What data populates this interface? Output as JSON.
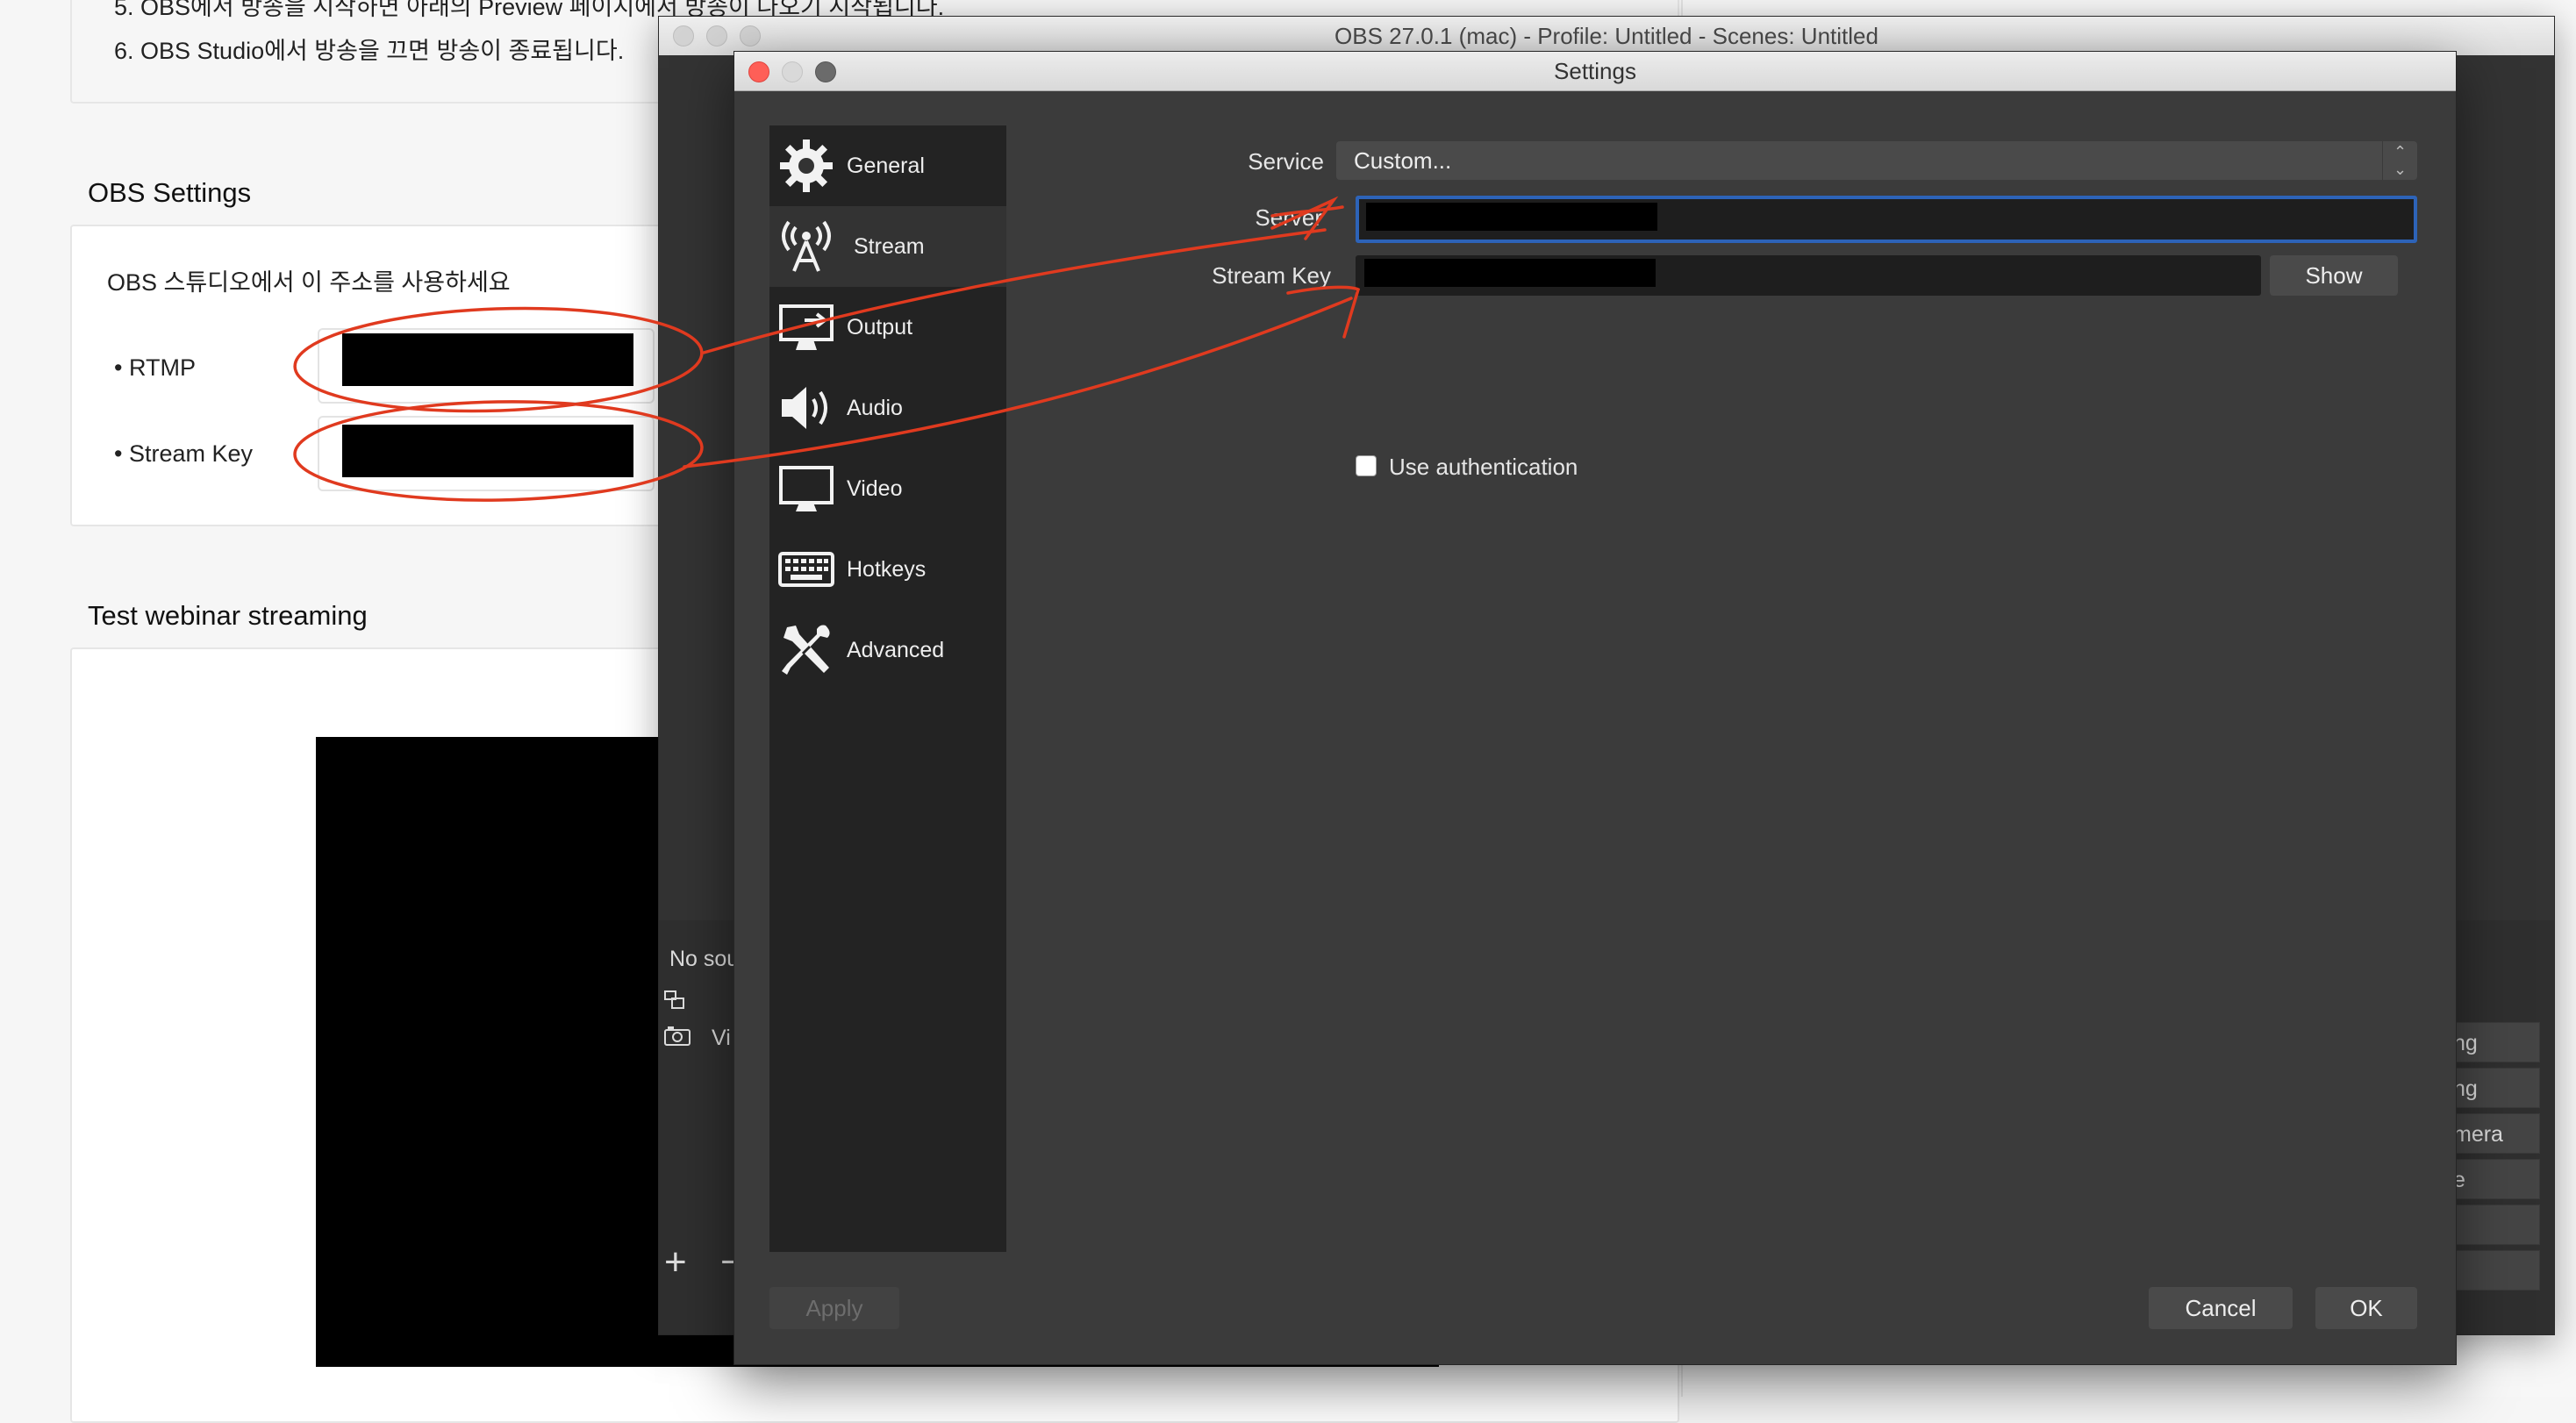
{
  "web": {
    "step5": "5. OBS에서 방송을 시작하면 아래의 Preview 페이지에서 방송이 나오기 시작됩니다.",
    "step6": "6. OBS Studio에서 방송을 끄면 방송이 종료됩니다.",
    "obs_settings_title": "OBS Settings",
    "obs_settings_desc": "OBS 스튜디오에서 이 주소를 사용하세요",
    "bullet_rtmp": "•   RTMP",
    "bullet_stream_key": "•   Stream Key",
    "test_title": "Test webinar streaming"
  },
  "obs_main": {
    "title": "OBS 27.0.1 (mac) - Profile: Untitled - Scenes: Untitled",
    "no_sources": "No sou",
    "source_item": "Vi",
    "add": "+",
    "remove": "−",
    "controls": [
      "ng",
      "ng",
      "mera",
      "e",
      "",
      ""
    ]
  },
  "settings": {
    "title": "Settings",
    "sidebar": [
      {
        "label": "General",
        "icon": "gear-icon",
        "active": false
      },
      {
        "label": "Stream",
        "icon": "antenna-icon",
        "active": true
      },
      {
        "label": "Output",
        "icon": "monitor-output-icon",
        "active": false
      },
      {
        "label": "Audio",
        "icon": "speaker-icon",
        "active": false
      },
      {
        "label": "Video",
        "icon": "display-icon",
        "active": false
      },
      {
        "label": "Hotkeys",
        "icon": "keyboard-icon",
        "active": false
      },
      {
        "label": "Advanced",
        "icon": "tools-icon",
        "active": false
      }
    ],
    "service_label": "Service",
    "service_value": "Custom...",
    "server_label": "Server",
    "stream_key_label": "Stream Key",
    "show_button": "Show",
    "use_auth": "Use authentication",
    "apply": "Apply",
    "cancel": "Cancel",
    "ok": "OK"
  },
  "colors": {
    "annotation": "#e03a1f",
    "focus": "#2d63b8",
    "dialog_bg": "#3b3b3b",
    "sidebar_bg": "#232323"
  }
}
